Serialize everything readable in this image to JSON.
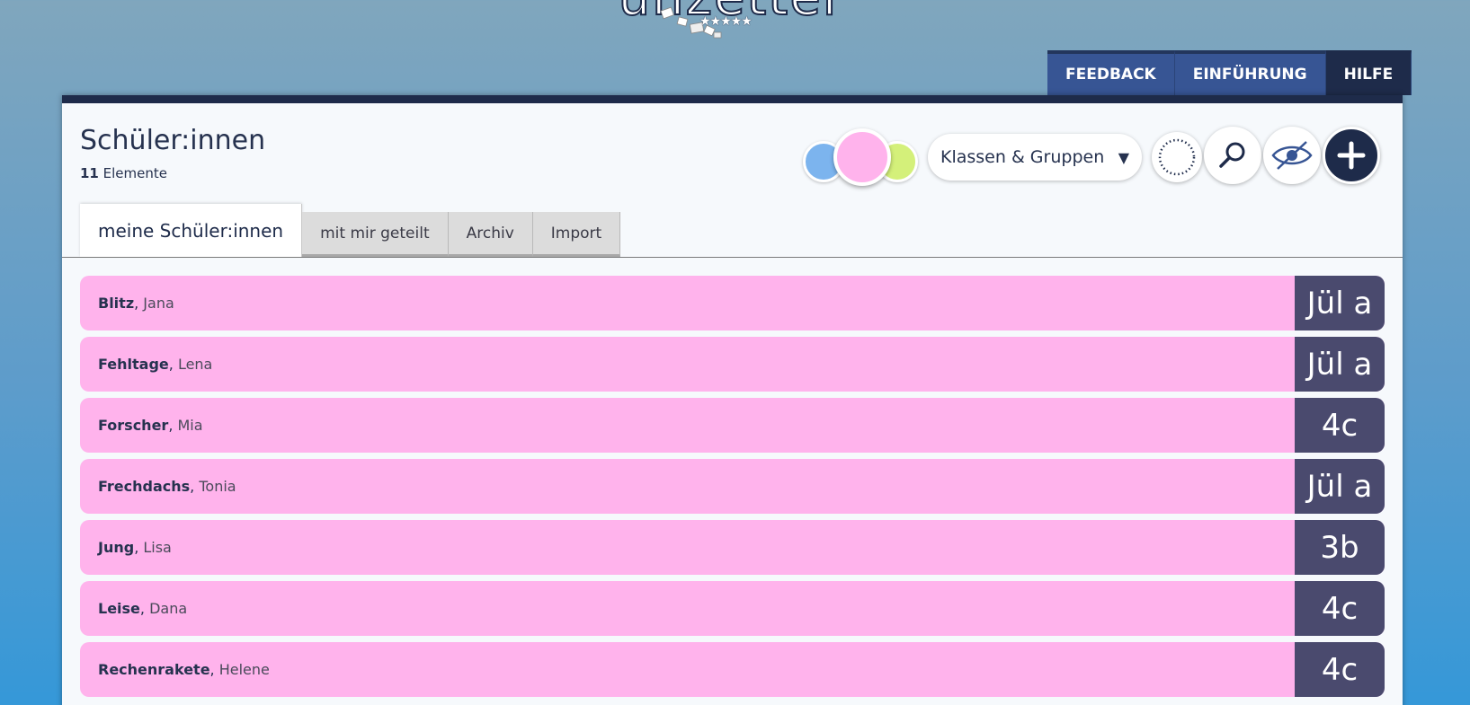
{
  "logo": {
    "text": "unzettel",
    "stars": "★★★★★"
  },
  "topnav": [
    {
      "label": "FEEDBACK"
    },
    {
      "label": "EINFÜHRUNG"
    },
    {
      "label": "HILFE"
    }
  ],
  "panel": {
    "title": "Schüler:innen",
    "count": "11",
    "count_label": "Elemente"
  },
  "toolbar": {
    "select_label": "Klassen & Gruppen",
    "select_arrow": "▼",
    "colors": {
      "blue": "#7cb4ee",
      "pink": "#ffb3ec",
      "green": "#d4f07a"
    },
    "icons": [
      "dotted-circle-icon",
      "search-icon",
      "eye-slash-icon",
      "plus-icon"
    ]
  },
  "tabs": [
    {
      "label": "meine Schüler:innen"
    },
    {
      "label": "mit mir geteilt"
    },
    {
      "label": "Archiv"
    },
    {
      "label": "Import"
    }
  ],
  "students": [
    {
      "last": "Blitz",
      "first": "Jana",
      "class": "Jül a"
    },
    {
      "last": "Fehltage",
      "first": "Lena",
      "class": "Jül a"
    },
    {
      "last": "Forscher",
      "first": "Mia",
      "class": "4c"
    },
    {
      "last": "Frechdachs",
      "first": "Tonia",
      "class": "Jül a"
    },
    {
      "last": "Jung",
      "first": "Lisa",
      "class": "3b"
    },
    {
      "last": "Leise",
      "first": "Dana",
      "class": "4c"
    },
    {
      "last": "Rechenrakete",
      "first": "Helene",
      "class": "4c"
    }
  ],
  "row_color": "#ffb3ec",
  "class_badge_color": "#4a4a6e"
}
